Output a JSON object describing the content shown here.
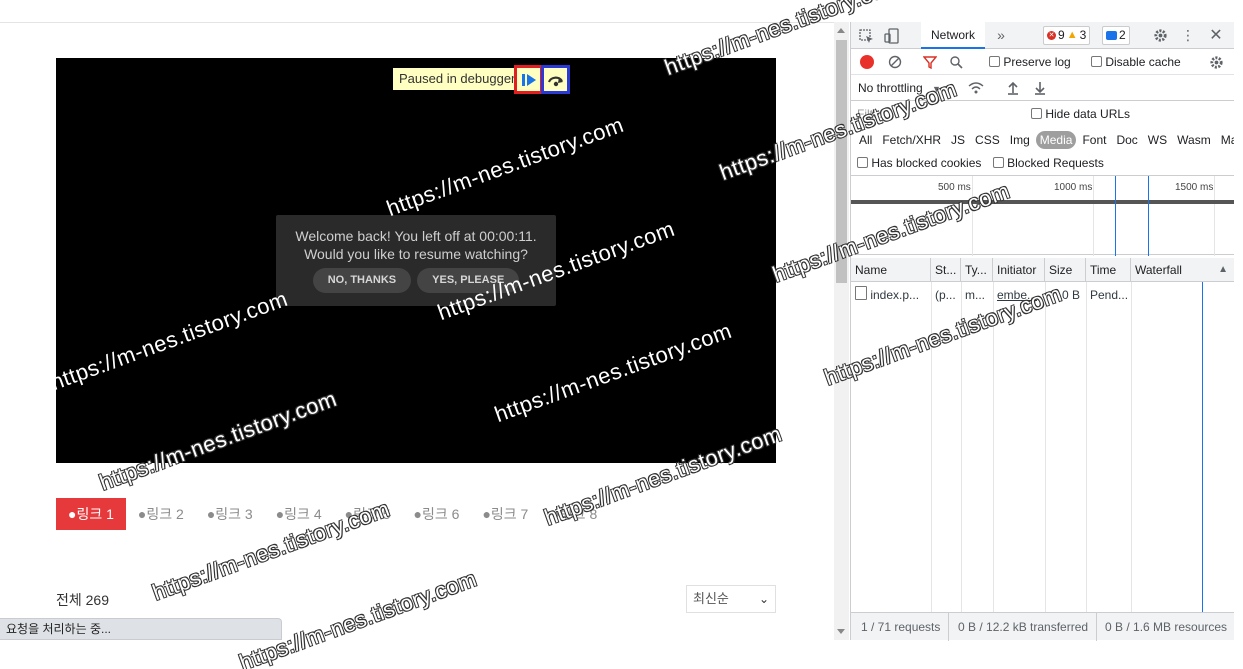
{
  "video": {
    "paused_label": "Paused in debugger",
    "resume_message_line1": "Welcome back! You left off at 00:00:11.",
    "resume_message_line2": "Would you like to resume watching?",
    "no_thanks": "NO, THANKS",
    "yes_please": "YES, PLEASE"
  },
  "tabs": [
    "●링크 1",
    "●링크 2",
    "●링크 3",
    "●링크 4",
    "●링크 5",
    "●링크 6",
    "●링크 7",
    "●링크 8"
  ],
  "list": {
    "total": "전체 269",
    "sort_selected": "최신순"
  },
  "status_bar": "요청을 처리하는 중...",
  "devtools": {
    "panel_tab": "Network",
    "more_tabs": "»",
    "errors": "9",
    "warnings": "3",
    "messages": "2",
    "preserve_log": "Preserve log",
    "disable_cache": "Disable cache",
    "throttling": "No throttling",
    "filter_placeholder": "Filter",
    "hide_data_urls": "Hide data URLs",
    "types": [
      "All",
      "Fetch/XHR",
      "JS",
      "CSS",
      "Img",
      "Media",
      "Font",
      "Doc",
      "WS",
      "Wasm",
      "Manifest"
    ],
    "selected_type": "Media",
    "has_blocked_cookies": "Has blocked cookies",
    "blocked_requests": "Blocked Requests",
    "timeline_labels": [
      "500 ms",
      "1000 ms",
      "1500 ms"
    ],
    "columns": [
      "Name",
      "St...",
      "Ty...",
      "Initiator",
      "Size",
      "Time",
      "Waterfall"
    ],
    "rows": [
      {
        "name": "index.p...",
        "status": "(p...",
        "type": "m...",
        "initiator": "embe...",
        "size": "0 B",
        "time": "Pend..."
      }
    ],
    "summary_requests": "1 / 71 requests",
    "summary_transferred": "0 B / 12.2 kB transferred",
    "summary_resources": "0 B / 1.6 MB resources"
  },
  "watermark": "https://m-nes.tistory.com",
  "colors": {
    "active_tab": "#e5393c",
    "record": "#e8312a",
    "accent": "#1a73e8"
  }
}
